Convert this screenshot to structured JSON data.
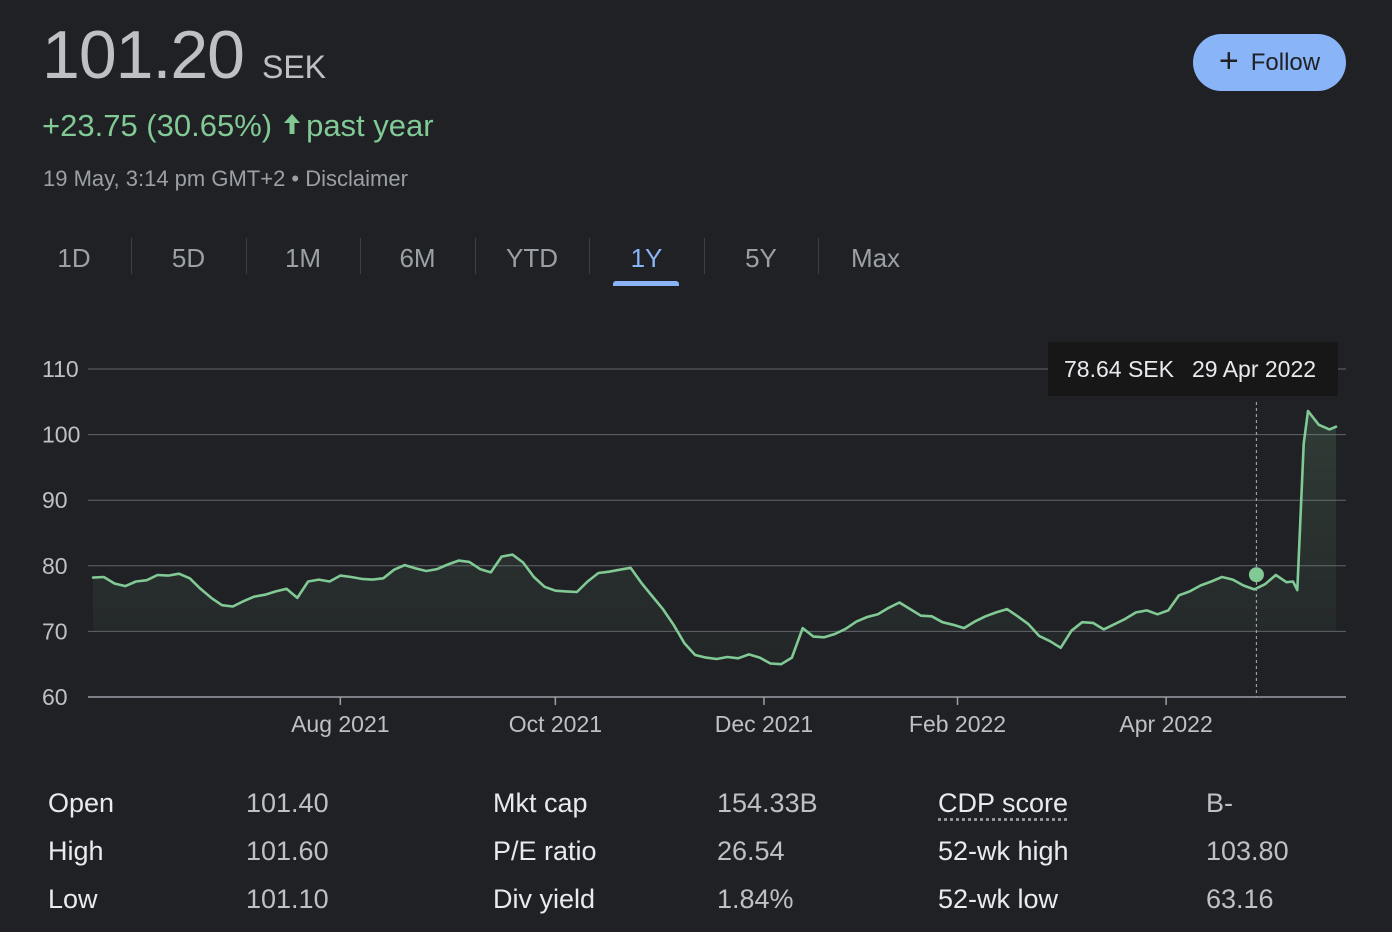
{
  "header": {
    "price": "101.20",
    "currency": "SEK",
    "change": "+23.75 (30.65%)",
    "period": "past year",
    "timestamp": "19 May, 3:14 pm GMT+2 • Disclaimer",
    "follow_label": "Follow"
  },
  "tabs": [
    {
      "label": "1D",
      "active": false
    },
    {
      "label": "5D",
      "active": false
    },
    {
      "label": "1M",
      "active": false
    },
    {
      "label": "6M",
      "active": false
    },
    {
      "label": "YTD",
      "active": false
    },
    {
      "label": "1Y",
      "active": true
    },
    {
      "label": "5Y",
      "active": false
    },
    {
      "label": "Max",
      "active": false
    }
  ],
  "colors": {
    "background": "#202124",
    "line": "#81c995",
    "accent": "#8ab4f8",
    "grid": "#5f6368"
  },
  "chart_data": {
    "type": "area",
    "series": [
      {
        "values": [
          [
            0,
            78.2
          ],
          [
            5,
            78.3
          ],
          [
            10,
            77.3
          ],
          [
            15,
            76.9
          ],
          [
            20,
            77.6
          ],
          [
            25,
            77.8
          ],
          [
            30,
            78.6
          ],
          [
            35,
            78.5
          ],
          [
            40,
            78.8
          ],
          [
            45,
            78.1
          ],
          [
            50,
            76.5
          ],
          [
            55,
            75.1
          ],
          [
            60,
            74.0
          ],
          [
            65,
            73.8
          ],
          [
            70,
            74.6
          ],
          [
            75,
            75.3
          ],
          [
            80,
            75.6
          ],
          [
            85,
            76.1
          ],
          [
            90,
            76.5
          ],
          [
            95,
            75.1
          ],
          [
            100,
            77.6
          ],
          [
            105,
            77.9
          ],
          [
            110,
            77.6
          ],
          [
            115,
            78.5
          ],
          [
            120,
            78.3
          ],
          [
            125,
            78.0
          ],
          [
            130,
            77.9
          ],
          [
            135,
            78.1
          ],
          [
            140,
            79.4
          ],
          [
            145,
            80.1
          ],
          [
            150,
            79.6
          ],
          [
            155,
            79.2
          ],
          [
            160,
            79.5
          ],
          [
            165,
            80.2
          ],
          [
            170,
            80.8
          ],
          [
            175,
            80.6
          ],
          [
            180,
            79.5
          ],
          [
            185,
            79.0
          ],
          [
            190,
            81.4
          ],
          [
            195,
            81.7
          ],
          [
            200,
            80.5
          ],
          [
            205,
            78.3
          ],
          [
            210,
            76.8
          ],
          [
            215,
            76.2
          ],
          [
            220,
            76.1
          ],
          [
            225,
            76.0
          ],
          [
            230,
            77.6
          ],
          [
            235,
            78.9
          ],
          [
            240,
            79.1
          ],
          [
            245,
            79.4
          ],
          [
            250,
            79.7
          ],
          [
            255,
            77.4
          ],
          [
            260,
            75.4
          ],
          [
            265,
            73.4
          ],
          [
            270,
            71.0
          ],
          [
            275,
            68.2
          ],
          [
            280,
            66.4
          ],
          [
            285,
            66.0
          ],
          [
            290,
            65.8
          ],
          [
            295,
            66.1
          ],
          [
            300,
            65.9
          ],
          [
            305,
            66.5
          ],
          [
            310,
            66.0
          ],
          [
            315,
            65.1
          ],
          [
            320,
            65.0
          ],
          [
            325,
            66.0
          ],
          [
            330,
            70.5
          ],
          [
            335,
            69.2
          ],
          [
            340,
            69.1
          ],
          [
            345,
            69.6
          ],
          [
            350,
            70.4
          ],
          [
            355,
            71.5
          ],
          [
            360,
            72.2
          ],
          [
            365,
            72.6
          ],
          [
            370,
            73.6
          ],
          [
            375,
            74.4
          ],
          [
            380,
            73.4
          ],
          [
            385,
            72.4
          ],
          [
            390,
            72.3
          ],
          [
            395,
            71.4
          ],
          [
            400,
            71.0
          ],
          [
            405,
            70.5
          ],
          [
            410,
            71.5
          ],
          [
            415,
            72.3
          ],
          [
            420,
            72.9
          ],
          [
            425,
            73.4
          ],
          [
            430,
            72.3
          ],
          [
            435,
            71.1
          ],
          [
            440,
            69.3
          ],
          [
            445,
            68.5
          ],
          [
            450,
            67.5
          ],
          [
            455,
            70.1
          ],
          [
            460,
            71.4
          ],
          [
            465,
            71.3
          ],
          [
            470,
            70.3
          ],
          [
            475,
            71.1
          ],
          [
            480,
            71.9
          ],
          [
            485,
            72.9
          ],
          [
            490,
            73.2
          ],
          [
            495,
            72.6
          ],
          [
            500,
            73.2
          ],
          [
            505,
            75.5
          ],
          [
            510,
            76.1
          ],
          [
            515,
            77.0
          ],
          [
            520,
            77.6
          ],
          [
            525,
            78.3
          ],
          [
            530,
            77.9
          ],
          [
            535,
            77.0
          ],
          [
            540,
            76.4
          ],
          [
            545,
            77.2
          ],
          [
            550,
            78.6
          ],
          [
            555,
            77.5
          ],
          [
            558,
            77.6
          ],
          [
            560,
            76.3
          ],
          [
            563,
            98.6
          ],
          [
            565,
            103.6
          ],
          [
            570,
            101.5
          ],
          [
            575,
            100.8
          ],
          [
            578,
            101.2
          ]
        ]
      }
    ],
    "x_ticks": [
      "Aug 2021",
      "Oct 2021",
      "Dec 2021",
      "Feb 2022",
      "Apr 2022"
    ],
    "x_tick_pos": [
      115,
      215,
      312,
      402,
      499
    ],
    "x_range": [
      0,
      578
    ],
    "y_ticks": [
      110,
      100,
      90,
      80,
      70,
      60
    ],
    "ylim": [
      60,
      110
    ],
    "grid": true,
    "baseline": 70,
    "tooltip": {
      "x": 541,
      "value": 78.64,
      "text_value": "78.64 SEK",
      "text_date": "29 Apr 2022"
    }
  },
  "stats": {
    "col1": [
      {
        "label": "Open",
        "value": "101.40"
      },
      {
        "label": "High",
        "value": "101.60"
      },
      {
        "label": "Low",
        "value": "101.10"
      }
    ],
    "col2": [
      {
        "label": "Mkt cap",
        "value": "154.33B"
      },
      {
        "label": "P/E ratio",
        "value": "26.54"
      },
      {
        "label": "Div yield",
        "value": "1.84%"
      }
    ],
    "col3": [
      {
        "label": "CDP score",
        "value": "B-"
      },
      {
        "label": "52-wk high",
        "value": "103.80"
      },
      {
        "label": "52-wk low",
        "value": "63.16"
      }
    ]
  }
}
